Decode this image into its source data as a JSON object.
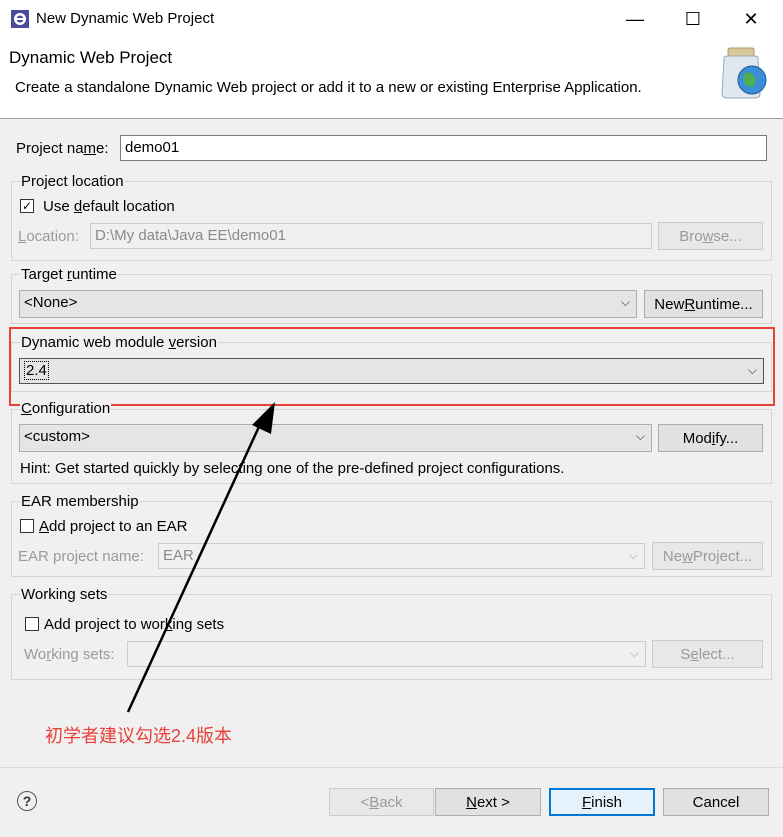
{
  "window": {
    "title": "New Dynamic Web Project",
    "minimize_glyph": "—",
    "maximize_glyph": "☐",
    "close_glyph": "✕"
  },
  "banner": {
    "title": "Dynamic Web Project",
    "description": "Create a standalone Dynamic Web project or add it to a new or existing Enterprise Application."
  },
  "project_name": {
    "pre": "Project na",
    "mnemonic": "m",
    "post": "e:",
    "value": "demo01"
  },
  "project_location": {
    "group_label": "Project location",
    "use_default_pre": "Use ",
    "use_default_mnemonic": "d",
    "use_default_post": "efault location",
    "use_default_checked": true,
    "location_mnemonic": "L",
    "location_post": "ocation:",
    "location_value": "D:\\My  data\\Java EE\\demo01",
    "browse_pre": "Bro",
    "browse_mnemonic": "w",
    "browse_post": "se..."
  },
  "target_runtime": {
    "label_pre": "Target ",
    "label_mnemonic": "r",
    "label_post": "untime",
    "value": "<None>",
    "new_runtime_pre": "New ",
    "new_runtime_mnemonic": "R",
    "new_runtime_post": "untime..."
  },
  "module_version": {
    "label_pre": "Dynamic web module ",
    "label_mnemonic": "v",
    "label_post": "ersion",
    "value": "2.4"
  },
  "configuration": {
    "label_mnemonic": "C",
    "label_post": "onfiguration",
    "value": "<custom>",
    "modify_pre": "Mod",
    "modify_mnemonic": "i",
    "modify_post": "fy...",
    "hint": "Hint: Get started quickly by selecting one of the pre-defined project configurations."
  },
  "ear": {
    "group_label": "EAR membership",
    "add_mnemonic": "A",
    "add_post": "dd project to an EAR",
    "add_checked": false,
    "name_pre": "EAR pro",
    "name_mnemonic": "j",
    "name_post": "ect name:",
    "name_value": "EAR",
    "new_project_pre": "Ne",
    "new_project_mnemonic": "w",
    "new_project_post": " Project..."
  },
  "working_sets": {
    "group_label": "Working sets",
    "add_pre": "Add project to wor",
    "add_mnemonic": "k",
    "add_post": "ing sets",
    "add_checked": false,
    "sets_pre": "Wo",
    "sets_mnemonic": "r",
    "sets_post": "king sets:",
    "sets_value": "",
    "select_pre": "S",
    "select_mnemonic": "e",
    "select_post": "lect..."
  },
  "annotation": {
    "text": "初学者建议勾选2.4版本",
    "color": "#e8413a"
  },
  "footer": {
    "help_glyph": "?",
    "back_pre": "< ",
    "back_mnemonic": "B",
    "back_post": "ack",
    "next_mnemonic": "N",
    "next_post": "ext >",
    "finish_mnemonic": "F",
    "finish_post": "inish",
    "cancel": "Cancel"
  }
}
